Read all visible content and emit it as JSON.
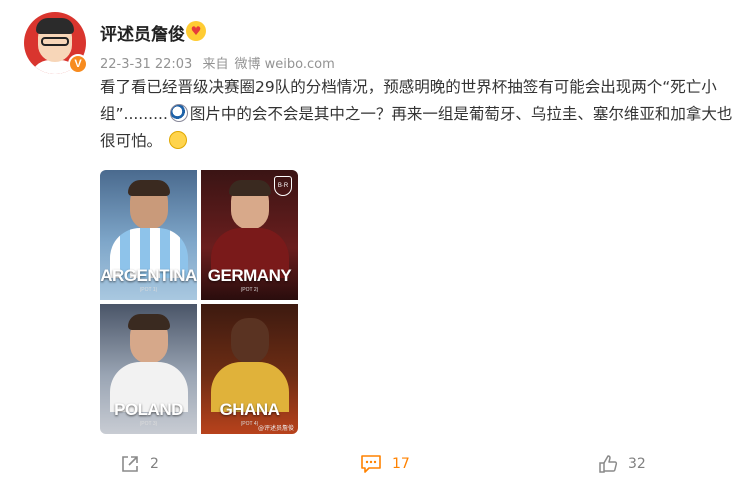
{
  "user": {
    "name": "评述员詹俊",
    "badge": "V"
  },
  "meta": {
    "time": "22-3-31 22:03",
    "source_prefix": "来自",
    "source": "微博 weibo.com"
  },
  "post": {
    "text_part1": "看了看已经晋级决赛圈29队的分档情况，预感明晚的世界杯抽签有可能会出现两个“死亡小组”.........",
    "text_part2": "图片中的会不会是其中之一？再来一组是葡萄牙、乌拉圭、塞尔维亚和加拿大也很可怕。"
  },
  "image": {
    "tiles": [
      {
        "country": "ARGENTINA",
        "pot": "(POT 1)"
      },
      {
        "country": "GERMANY",
        "pot": "(POT 2)"
      },
      {
        "country": "POLAND",
        "pot": "(POT 3)"
      },
      {
        "country": "GHANA",
        "pot": "(POT 4)"
      }
    ],
    "logo": "B·R",
    "watermark": "@评述员詹俊"
  },
  "actions": {
    "repost_count": "2",
    "comment_count": "17",
    "like_count": "32"
  },
  "colors": {
    "accent_comment": "#ff8200",
    "username": "#222222",
    "meta": "#939393"
  }
}
